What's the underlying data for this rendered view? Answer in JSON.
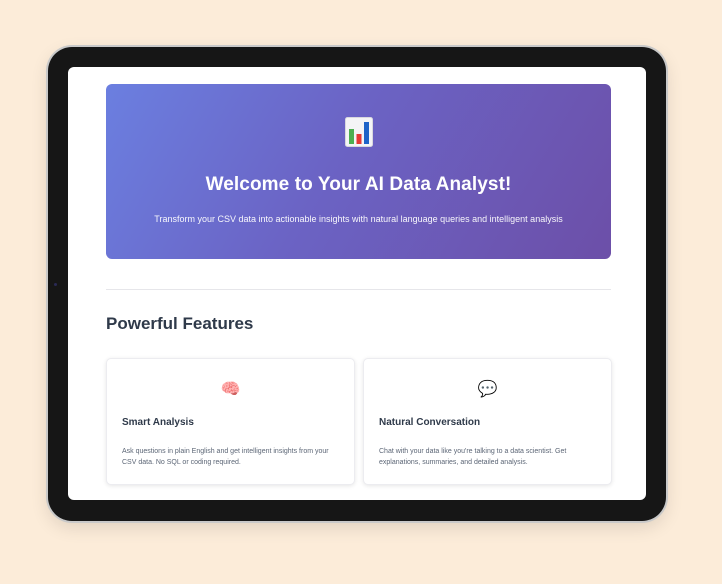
{
  "hero": {
    "icon": "bar-chart-icon",
    "title": "Welcome to Your AI Data Analyst!",
    "subtitle": "Transform your CSV data into actionable insights with natural language queries and intelligent analysis"
  },
  "features": {
    "heading": "Powerful Features",
    "cards": [
      {
        "icon": "brain-icon",
        "title": "Smart Analysis",
        "description": "Ask questions in plain English and get intelligent insights from your CSV data. No SQL or coding required."
      },
      {
        "icon": "speech-bubble-icon",
        "title": "Natural Conversation",
        "description": "Chat with your data like you're talking to a data scientist. Get explanations, summaries, and detailed analysis."
      }
    ]
  },
  "colors": {
    "background": "#fcecd9",
    "hero_gradient_start": "#6b7fe0",
    "hero_gradient_end": "#6c4fa8",
    "heading_text": "#2f3a4a"
  }
}
